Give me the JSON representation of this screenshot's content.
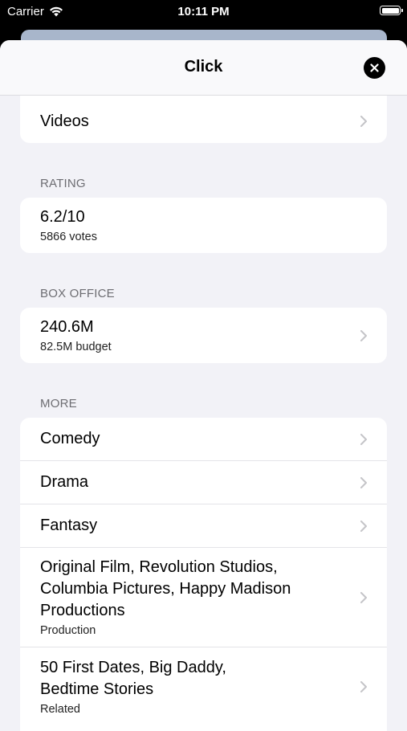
{
  "status": {
    "carrier": "Carrier",
    "time": "10:11 PM"
  },
  "nav": {
    "title": "Click"
  },
  "videos": {
    "label": "Videos"
  },
  "rating": {
    "header": "RATING",
    "value": "6.2/10",
    "votes": "5866 votes"
  },
  "box_office": {
    "header": "BOX OFFICE",
    "value": "240.6M",
    "budget": "82.5M budget"
  },
  "more": {
    "header": "MORE",
    "items": [
      {
        "title": "Comedy"
      },
      {
        "title": "Drama"
      },
      {
        "title": "Fantasy"
      },
      {
        "title": "Original Film, Revolution Studios, Columbia Pictures, Happy Madison Productions",
        "subtitle": "Production"
      },
      {
        "title": "50 First Dates, Big Daddy, Bedtime Stories",
        "subtitle": "Related"
      }
    ]
  },
  "colors": {
    "sheet_bg": "#f2f2f7",
    "card_bg": "#ffffff",
    "header_text": "#6d6d72",
    "chevron": "#c4c4c8"
  }
}
